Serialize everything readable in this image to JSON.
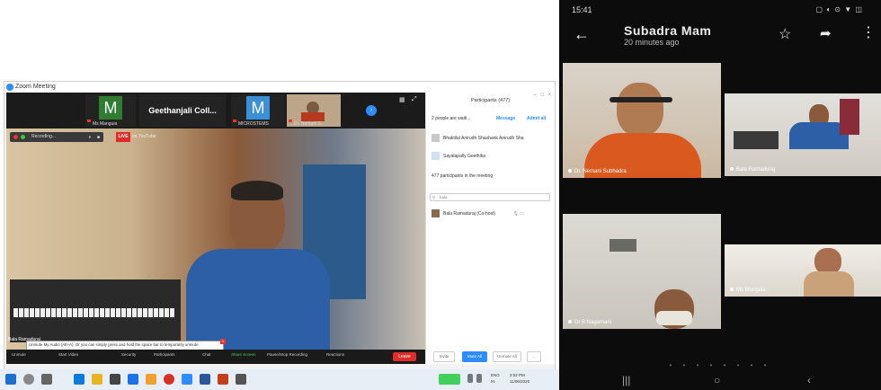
{
  "zoom": {
    "window_title": "Zoom Meeting",
    "tiles": [
      {
        "letter": "M",
        "name": "Ms Manguia",
        "color": "#2e7d32"
      },
      {
        "letter": "",
        "name": "Geethanjali Coll...",
        "color": "#1e1e1e"
      },
      {
        "letter": "M",
        "name": "MICROSTEMS",
        "color": "#3a8fd6"
      },
      {
        "letter": "",
        "name": "Dr. Nemani S.",
        "color": "#7a5a40"
      }
    ],
    "recording_label": "Recording...",
    "live_label": "LIVE",
    "live_destination": "on YouTube",
    "speaker_name": "Bala Ramaduraj",
    "tooltip_text": "Unmute My Audio (Alt+A). Or you can simply press and hold the space bar to temporarily unmute.",
    "controls": [
      {
        "label": "Unmute"
      },
      {
        "label": "Start Video"
      },
      {
        "label": "Security"
      },
      {
        "label": "Participants"
      },
      {
        "label": "Chat"
      },
      {
        "label": "Share Screen",
        "active": true
      },
      {
        "label": "Pause/Stop Recording"
      },
      {
        "label": "Reactions"
      }
    ],
    "leave_label": "Leave",
    "participants": {
      "title": "Participants (477)",
      "waiting_text": "2 people are waiti...",
      "message_label": "Message",
      "admit_all_label": "Admit all",
      "waiting": [
        "Bhaktilal Anirudh Shashank Anirudh Sha",
        "Sayalapally Geethika"
      ],
      "in_meeting_text": "477 participants in the meeting",
      "search_value": "bala",
      "host_entry": "Bala Ramaduraj (Co-host)",
      "footer_buttons": [
        "Invite",
        "Mute All",
        "Unmute All",
        "..."
      ]
    }
  },
  "taskbar": {
    "lang": "ENG",
    "lang2": "IN",
    "time": "3:52 PM",
    "date": "11/06/2020"
  },
  "phone": {
    "status_time": "15:41",
    "status_icons": "▢ ◐ ⊙ ▼ ◫",
    "chat_name": "Subadra Mam",
    "chat_time": "20 minutes ago",
    "tiles": [
      {
        "caption": "Dr. Nemani Subhadra"
      },
      {
        "caption": "Bala Ramaduraj"
      },
      {
        "caption": "Dr B Nagamani"
      },
      {
        "caption": "Ms Manguia"
      }
    ],
    "page_dots": "• • • • • • • •"
  },
  "colors": {
    "zoom_blue": "#2d8cff",
    "live_red": "#e02b2b",
    "phone_bg": "#0c0c0c"
  }
}
